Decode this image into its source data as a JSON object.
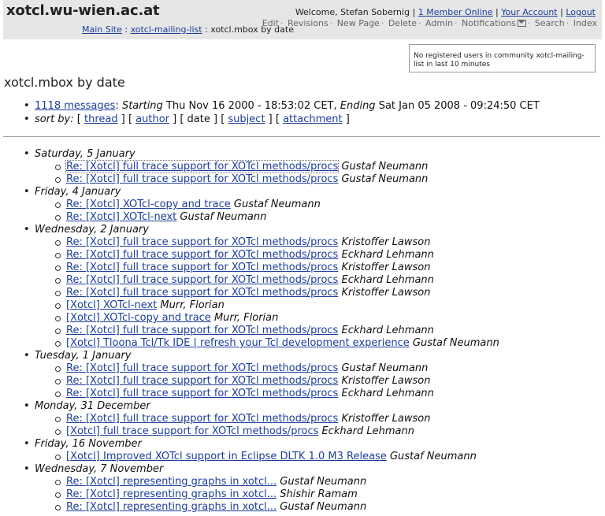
{
  "site": {
    "title": "xotcl.wu-wien.ac.at"
  },
  "breadcrumb": {
    "main": "Main Site",
    "sep1": " : ",
    "list": "xotcl-mailing-list",
    "sep2": " : ",
    "current": "xotcl.mbox by date"
  },
  "user": {
    "welcome": "Welcome, Stefan Sobernig",
    "members_online": "1 Member Online",
    "account": "Your Account",
    "logout": "Logout"
  },
  "actions": [
    "Edit",
    "Revisions",
    "New Page",
    "Delete",
    "Admin",
    "Notifications",
    "Search",
    "Index"
  ],
  "online_box": {
    "text": "No registered users in community xotcl-mailing-list in last 10 minutes"
  },
  "page_title": "xotcl.mbox by date",
  "summary": {
    "messages_link": "1118 messages",
    "starting_label": "Starting",
    "starting_value": "Thu Nov 16 2000 - 18:53:02 CET,",
    "ending_label": "Ending",
    "ending_value": "Sat Jan 05 2008 - 09:24:50 CET",
    "sort_label": "sort by:",
    "sort_thread": "thread",
    "sort_author": "author",
    "sort_date": "date",
    "sort_subject": "subject",
    "sort_attachment": "attachment"
  },
  "days": [
    {
      "label": "Saturday, 5 January",
      "messages": [
        {
          "subject": "Re: [Xotcl] full trace support for XOTcl methods/procs",
          "author": "Gustaf Neumann"
        },
        {
          "subject": "Re: [Xotcl] full trace support for XOTcl methods/procs",
          "author": "Gustaf Neumann"
        }
      ]
    },
    {
      "label": "Friday, 4 January",
      "messages": [
        {
          "subject": "Re: [Xotcl] XOTcl-copy and trace",
          "author": "Gustaf Neumann"
        },
        {
          "subject": "Re: [Xotcl] XOTcl-next",
          "author": "Gustaf Neumann"
        }
      ]
    },
    {
      "label": "Wednesday, 2 January",
      "messages": [
        {
          "subject": "Re: [Xotcl] full trace support for XOTcl methods/procs",
          "author": "Kristoffer Lawson"
        },
        {
          "subject": "Re: [Xotcl] full trace support for XOTcl methods/procs",
          "author": "Eckhard Lehmann"
        },
        {
          "subject": "Re: [Xotcl] full trace support for XOTcl methods/procs",
          "author": "Kristoffer Lawson"
        },
        {
          "subject": "Re: [Xotcl] full trace support for XOTcl methods/procs",
          "author": "Eckhard Lehmann"
        },
        {
          "subject": "Re: [Xotcl] full trace support for XOTcl methods/procs",
          "author": "Kristoffer Lawson"
        },
        {
          "subject": "[Xotcl] XOTcl-next",
          "author": "Murr, Florian"
        },
        {
          "subject": "[Xotcl] XOTcl-copy and trace",
          "author": "Murr, Florian"
        },
        {
          "subject": "Re: [Xotcl] full trace support for XOTcl methods/procs",
          "author": "Eckhard Lehmann"
        },
        {
          "subject": "[Xotcl] Tloona Tcl/Tk IDE | refresh your Tcl development experience",
          "author": "Gustaf Neumann"
        }
      ]
    },
    {
      "label": "Tuesday, 1 January",
      "messages": [
        {
          "subject": "Re: [Xotcl] full trace support for XOTcl methods/procs",
          "author": "Gustaf Neumann"
        },
        {
          "subject": "Re: [Xotcl] full trace support for XOTcl methods/procs",
          "author": "Kristoffer Lawson"
        },
        {
          "subject": "Re: [Xotcl] full trace support for XOTcl methods/procs",
          "author": "Eckhard Lehmann"
        }
      ]
    },
    {
      "label": "Monday, 31 December",
      "messages": [
        {
          "subject": "Re: [Xotcl] full trace support for XOTcl methods/procs",
          "author": "Kristoffer Lawson"
        },
        {
          "subject": "[Xotcl] full trace support for XOTcl methods/procs",
          "author": "Eckhard Lehmann"
        }
      ]
    },
    {
      "label": "Friday, 16 November",
      "messages": [
        {
          "subject": "[Xotcl] Improved XOTcl support in Eclipse DLTK 1.0 M3 Release",
          "author": "Gustaf Neumann"
        }
      ]
    },
    {
      "label": "Wednesday, 7 November",
      "messages": [
        {
          "subject": "Re: [Xotcl] representing graphs in xotcl...",
          "author": "Gustaf Neumann"
        },
        {
          "subject": "Re: [Xotcl] representing graphs in xotcl...",
          "author": "Shishir Ramam"
        },
        {
          "subject": "Re: [Xotcl] representing graphs in xotcl...",
          "author": "Gustaf Neumann"
        }
      ]
    }
  ]
}
